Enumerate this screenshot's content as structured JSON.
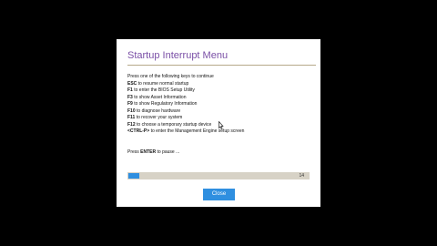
{
  "dialog": {
    "title": "Startup Interrupt Menu",
    "intro": "Press one of the following keys to continue",
    "options": [
      {
        "key": "ESC",
        "text": "to resume normal startup"
      },
      {
        "key": "F1",
        "text": "to enter the BIOS Setup Utility"
      },
      {
        "key": "F3",
        "text": "to show Asset Information"
      },
      {
        "key": "F9",
        "text": "to show Regulatory Information"
      },
      {
        "key": "F10",
        "text": "to diagnose hardware"
      },
      {
        "key": "F11",
        "text": "to recover your system"
      },
      {
        "key": "F12",
        "text": "to choose a temporary startup device"
      },
      {
        "key": "<CTRL-P>",
        "text": "to enter the Management Engine setup screen"
      }
    ],
    "pause_prefix": "Press",
    "pause_key": "ENTER",
    "pause_suffix": "to pause ...",
    "progress": {
      "countdown": "14",
      "fraction": 0.06
    },
    "close_label": "Close"
  },
  "colors": {
    "title": "#7a4fa6",
    "accent": "#2f8fe0",
    "background": "#000000"
  },
  "icons": {
    "cursor": "mouse-pointer-icon"
  }
}
